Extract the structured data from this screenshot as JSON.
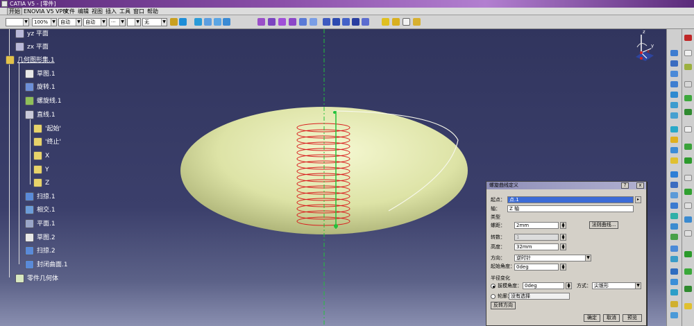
{
  "window": {
    "title": "CATIA V5 - [零件]"
  },
  "menu": {
    "items": [
      "开始",
      "ENOVIA V5 VPM",
      "文件",
      "编辑",
      "视图",
      "插入",
      "工具",
      "窗口",
      "帮助"
    ]
  },
  "toolbar": {
    "zoom": "100%",
    "dd_auto1": "自动",
    "dd_auto2": "自动",
    "dd_pt": "···",
    "dd_none": "无"
  },
  "tree": {
    "items": [
      "yz 平面",
      "zx 平面",
      "几何图形集.1",
      "草图.1",
      "旋转.1",
      "螺旋线.1",
      "直线.1",
      "'起始'",
      "'终止'",
      "X",
      "Y",
      "Z",
      "扫掠.1",
      "相交.1",
      "平面.1",
      "草图.2",
      "扫掠.2",
      "封闭曲面.1",
      "零件几何体"
    ]
  },
  "compass": {
    "z": "z",
    "x": "x",
    "y": "y"
  },
  "dialog": {
    "title": "螺旋曲线定义",
    "help_btn": "?",
    "close_btn": "x",
    "start_label": "起点：",
    "start_value": "点.1",
    "axis_label": "轴：",
    "axis_value": "Z 轴",
    "type_label": "类型",
    "pitch_label": "螺距：",
    "pitch_value": "2mm",
    "law_btn": "法则曲线...",
    "turns_label": "转数：",
    "turns_value": "1",
    "height_label": "高度：",
    "height_value": "32mm",
    "direction_label": "方向：",
    "direction_value": "逆时针",
    "start_angle_label": "起始角度：",
    "start_angle_value": "0deg",
    "radius_label": "半径变化",
    "taper_label": "拔模角度：",
    "taper_value": "0deg",
    "way_label": "方式：",
    "way_value": "尖锥形",
    "profile_label": "轮廓：",
    "profile_value": "没有选择",
    "reverse_btn": "反转方向",
    "ok_btn": "确定",
    "cancel_btn": "取消",
    "preview_btn": "预览"
  }
}
